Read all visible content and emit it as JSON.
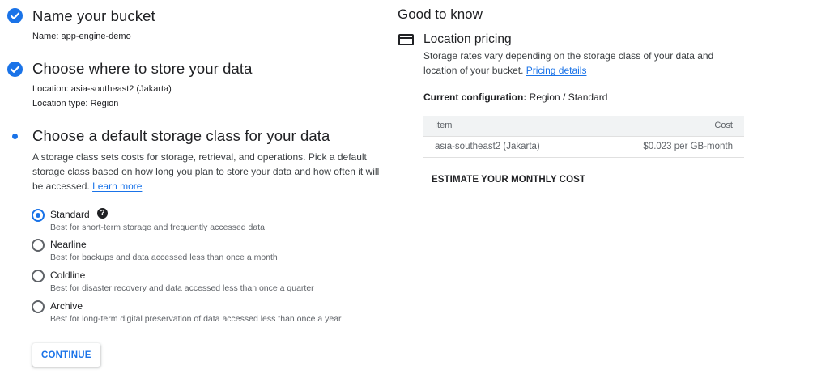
{
  "steps": [
    {
      "title": "Name your bucket",
      "status": "complete",
      "details": [
        {
          "label": "Name:",
          "value": "app-engine-demo"
        }
      ]
    },
    {
      "title": "Choose where to store your data",
      "status": "complete",
      "details": [
        {
          "label": "Location:",
          "value": "asia-southeast2 (Jakarta)"
        },
        {
          "label": "Location type:",
          "value": "Region"
        }
      ]
    },
    {
      "title": "Choose a default storage class for your data",
      "status": "active",
      "description": "A storage class sets costs for storage, retrieval, and operations. Pick a default storage class based on how long you plan to store your data and how often it will be accessed.",
      "learn_more": "Learn more"
    }
  ],
  "storage_classes": [
    {
      "label": "Standard",
      "desc": "Best for short-term storage and frequently accessed data",
      "selected": true
    },
    {
      "label": "Nearline",
      "desc": "Best for backups and data accessed less than once a month",
      "selected": false
    },
    {
      "label": "Coldline",
      "desc": "Best for disaster recovery and data accessed less than once a quarter",
      "selected": false
    },
    {
      "label": "Archive",
      "desc": "Best for long-term digital preservation of data accessed less than once a year",
      "selected": false
    }
  ],
  "help_glyph": "?",
  "continue_label": "CONTINUE",
  "right": {
    "title": "Good to know",
    "icon": "credit-card-icon",
    "subtitle": "Location pricing",
    "description": "Storage rates vary depending on the storage class of your data and location of your bucket.",
    "pricing_link": "Pricing details",
    "config_label": "Current configuration:",
    "config_value": "Region / Standard",
    "table": {
      "headers": [
        "Item",
        "Cost"
      ],
      "rows": [
        [
          "asia-southeast2 (Jakarta)",
          "$0.023 per GB-month"
        ]
      ]
    },
    "estimate_label": "ESTIMATE YOUR MONTHLY COST"
  },
  "colors": {
    "accent": "#1a73e8",
    "text": "#202124",
    "secondary_text": "#5f6368"
  }
}
